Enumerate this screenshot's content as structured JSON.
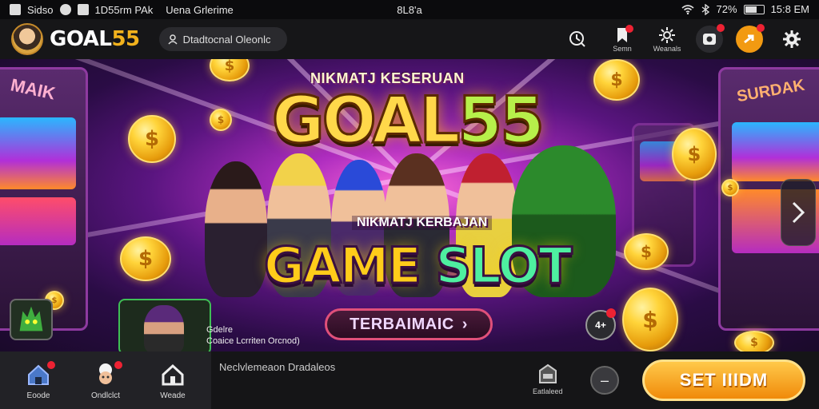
{
  "statusbar": {
    "left_text": "Sidso",
    "time_text": "1D55rm PAk",
    "carrier": "Uena Grlerime",
    "center": "8L8'a",
    "battery_pct": "72%",
    "clock": "15:8 EM"
  },
  "header": {
    "brand_main": "GOAL",
    "brand_num": "55",
    "search_text": "Dtadtocnal Oleonlc",
    "icons": [
      {
        "name": "timer-icon",
        "label": ""
      },
      {
        "name": "bookmark-icon",
        "label": "Semn"
      },
      {
        "name": "gear-icon",
        "label": "Weanals"
      },
      {
        "name": "camera-icon",
        "label": ""
      },
      {
        "name": "arrow-icon",
        "label": ""
      },
      {
        "name": "settings-icon",
        "label": ""
      }
    ]
  },
  "banner": {
    "tagline_top": "NIKMATJ KESERUAN",
    "logo_main": "GOAL",
    "logo_num": "55",
    "tagline_mid": "NIKMATJ KERBAJAN",
    "game_word": "GAME",
    "slot_word": "SLOT",
    "cta_label": "TERBAIMAIC",
    "cta_arrow": "›",
    "left_cabinet_sign": "MAIK",
    "right_cabinet_sign": "SURDAK",
    "mini_title": "Gdelre",
    "mini_sub": "Coaice Lcrriten Orcnod)",
    "circ_label": "4+"
  },
  "bottombar": {
    "items": [
      {
        "name": "home-icon",
        "label": "Eoode"
      },
      {
        "name": "chef-icon",
        "label": "Ondlclct"
      },
      {
        "name": "house-icon",
        "label": "Weade"
      }
    ],
    "ticker": "Neclvlemeaon Dradaleos",
    "shop_label": "Eatlaleed",
    "minus_label": "–",
    "big_button": "SET IIIDM"
  }
}
